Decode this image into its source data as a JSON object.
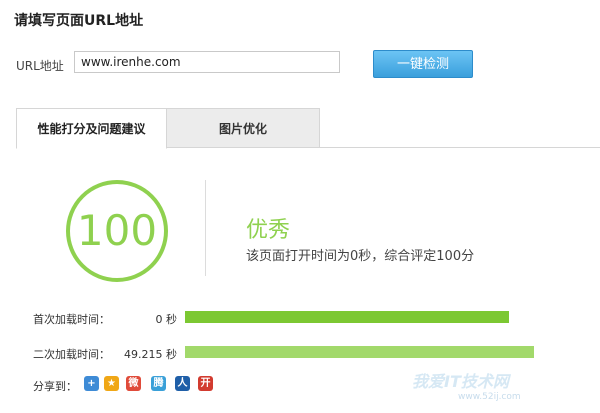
{
  "header": {
    "title": "请填写页面URL地址"
  },
  "url_form": {
    "label": "URL地址",
    "value": "www.irenhe.com",
    "button_label": "一键检测"
  },
  "tabs": [
    {
      "label": "性能打分及问题建议",
      "active": true
    },
    {
      "label": "图片优化",
      "active": false
    }
  ],
  "score": {
    "value": "100",
    "grade": "优秀",
    "description": "该页面打开时间为0秒，综合评定100分",
    "color": "#8fd14f"
  },
  "load_times": [
    {
      "label": "首次加载时间：",
      "value": "0 秒",
      "bar_fraction": 0.926,
      "bar_color": "#7cc832"
    },
    {
      "label": "二次加载时间：",
      "value": "49.215 秒",
      "bar_fraction": 0.997,
      "bar_color": "#a2d96b"
    }
  ],
  "share": {
    "label": "分享到：",
    "icons": [
      {
        "name": "plus-share-icon",
        "glyph": "+",
        "color": "#3e8bd6"
      },
      {
        "name": "qzone-star-icon",
        "glyph": "★",
        "color": "#f0a716"
      },
      {
        "name": "weibo-icon",
        "glyph": "微",
        "color": "#e04b3a"
      },
      {
        "name": "tencent-weibo-icon",
        "glyph": "腾",
        "color": "#3aa0d8"
      },
      {
        "name": "renren-icon",
        "glyph": "人",
        "color": "#1f5fa8"
      },
      {
        "name": "kaixin-icon",
        "glyph": "开",
        "color": "#d23b2f"
      }
    ]
  },
  "watermark": {
    "logo": "我爱IT技术网",
    "url": "www.52ij.com"
  }
}
